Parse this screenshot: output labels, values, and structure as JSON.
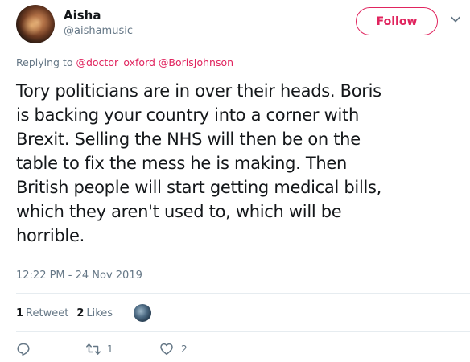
{
  "author": {
    "display_name": "Aisha",
    "handle": "@aishamusic"
  },
  "follow_button_label": "Follow",
  "reply_context": {
    "prefix": "Replying to",
    "mentions": [
      "@doctor_oxford",
      "@BorisJohnson"
    ]
  },
  "tweet": {
    "lines": [
      "Tory politicians are in over their heads. Boris",
      "is backing your country into a corner with",
      "Brexit. Selling the NHS will then be on the",
      "table to fix the mess he is making. Then",
      "British people will start getting medical bills,",
      "which they aren't used to, which will be",
      "horrible."
    ],
    "timestamp": "12:22 PM - 24 Nov 2019"
  },
  "stats": {
    "retweets_count": "1",
    "retweets_label": "Retweet",
    "likes_count": "2",
    "likes_label": "Likes"
  },
  "actions": {
    "reply_count": "",
    "retweet_count": "1",
    "like_count": "2"
  },
  "colors": {
    "accent": "#e0245e",
    "secondary_text": "#657786",
    "primary_text": "#14171a",
    "divider": "#e6ecf0"
  },
  "icons": {
    "more": "chevron-down-icon",
    "reply": "reply-icon",
    "retweet": "retweet-icon",
    "like": "heart-icon"
  }
}
